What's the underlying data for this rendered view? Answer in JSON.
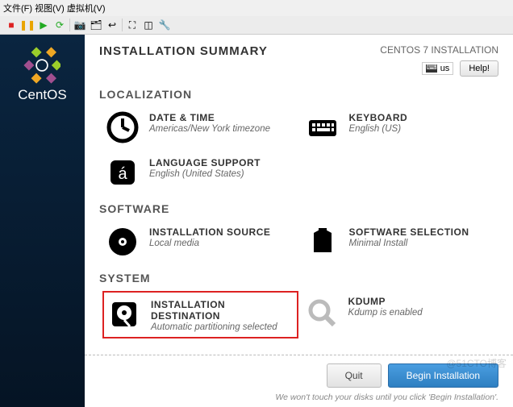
{
  "menubar": "文件(F)  视图(V)  虚拟机(V)",
  "logo_text": "CentOS",
  "header": {
    "title": "INSTALLATION SUMMARY",
    "subtitle": "CENTOS 7 INSTALLATION",
    "lang_code": "us",
    "help": "Help!"
  },
  "sections": {
    "localization": {
      "label": "LOCALIZATION",
      "date": {
        "title": "DATE & TIME",
        "sub": "Americas/New York timezone"
      },
      "keyboard": {
        "title": "KEYBOARD",
        "sub": "English (US)"
      },
      "language": {
        "title": "LANGUAGE SUPPORT",
        "sub": "English (United States)"
      }
    },
    "software": {
      "label": "SOFTWARE",
      "source": {
        "title": "INSTALLATION SOURCE",
        "sub": "Local media"
      },
      "selection": {
        "title": "SOFTWARE SELECTION",
        "sub": "Minimal Install"
      }
    },
    "system": {
      "label": "SYSTEM",
      "dest": {
        "title": "INSTALLATION DESTINATION",
        "sub": "Automatic partitioning selected"
      },
      "kdump": {
        "title": "KDUMP",
        "sub": "Kdump is enabled"
      }
    }
  },
  "footer": {
    "quit": "Quit",
    "begin": "Begin Installation",
    "note": "We won't touch your disks until you click 'Begin Installation'."
  },
  "watermark": "@51CTO博客"
}
